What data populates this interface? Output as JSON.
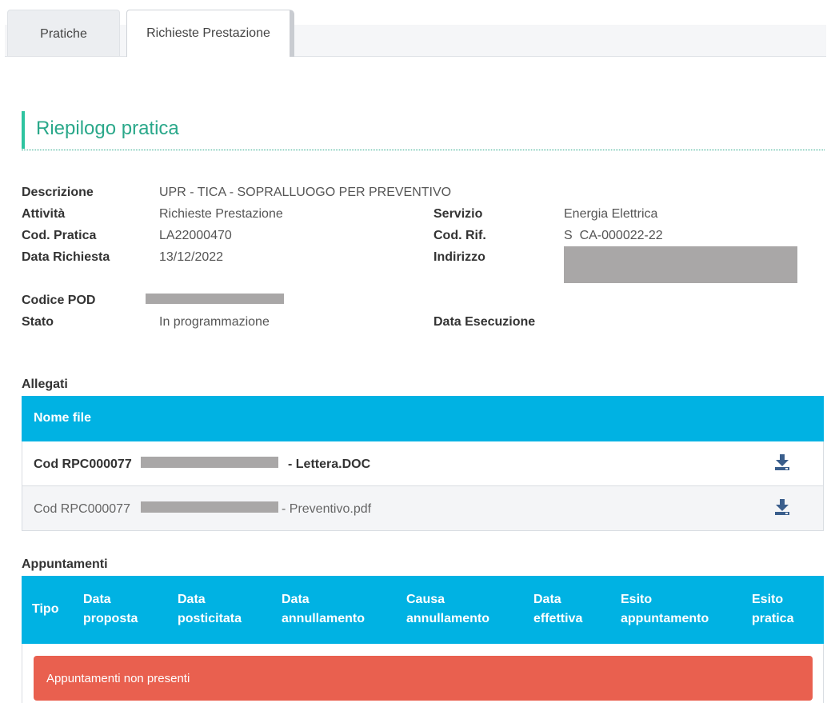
{
  "tabs": [
    {
      "label": "Pratiche",
      "active": false
    },
    {
      "label": "Richieste Prestazione",
      "active": true
    }
  ],
  "section_title": "Riepilogo pratica",
  "details": {
    "descrizione": {
      "label": "Descrizione",
      "value": "UPR - TICA - SOPRALLUOGO PER PREVENTIVO"
    },
    "attivita": {
      "label": "Attività",
      "value": "Richieste Prestazione"
    },
    "cod_pratica": {
      "label": "Cod. Pratica",
      "value": "LA22000470"
    },
    "data_richiesta": {
      "label": "Data Richiesta",
      "value": "13/12/2022"
    },
    "servizio": {
      "label": "Servizio",
      "value": "Energia Elettrica"
    },
    "cod_rif": {
      "label": "Cod. Rif.",
      "value": "S  CA-000022-22"
    },
    "indirizzo": {
      "label": "Indirizzo"
    },
    "codice_pod": {
      "label": "Codice POD"
    },
    "stato": {
      "label": "Stato",
      "value": "In programmazione"
    },
    "data_esecuzione": {
      "label": "Data Esecuzione"
    }
  },
  "allegati": {
    "heading": "Allegati",
    "column": "Nome file",
    "rows": [
      {
        "prefix": "Cod RPC000077",
        "suffix": "- Lettera.DOC",
        "icon": "download-icon"
      },
      {
        "prefix": "Cod RPC000077",
        "suffix": "- Preventivo.pdf",
        "icon": "download-icon"
      }
    ]
  },
  "appuntamenti": {
    "heading": "Appuntamenti",
    "columns": {
      "tipo": "Tipo",
      "data_proposta": [
        "Data",
        "proposta"
      ],
      "data_posticipata": [
        "Data",
        "posticitata"
      ],
      "data_annullamento": [
        "Data",
        "annullamento"
      ],
      "causa_annullamento": [
        "Causa",
        "annullamento"
      ],
      "data_effettiva": [
        "Data",
        "effettiva"
      ],
      "esito_appuntamento": [
        "Esito",
        "appuntamento"
      ],
      "esito_pratica": [
        "Esito",
        "pratica"
      ]
    },
    "empty_message": "Appuntamenti non presenti"
  },
  "colors": {
    "accent": "#2aa88a",
    "table_header": "#00b2e3",
    "alert": "#e9604f"
  }
}
